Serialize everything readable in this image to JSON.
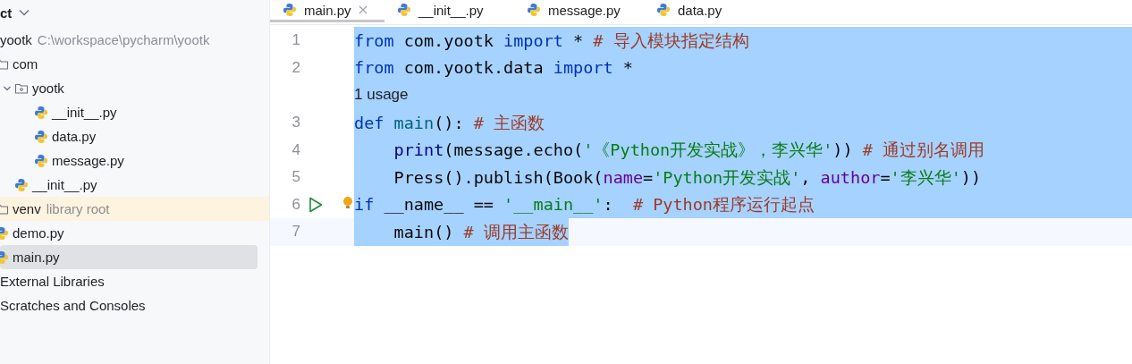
{
  "project_header": {
    "label": "ct"
  },
  "tree": [
    {
      "name": "yootk",
      "path": "C:\\workspace\\pycharm\\yootk",
      "selected": false,
      "children": [
        {
          "name": "com",
          "kind": "folder",
          "selected": false,
          "children": [
            {
              "name": "yootk",
              "kind": "package",
              "expanded": true,
              "selected": false,
              "children": [
                {
                  "name": "__init__.py",
                  "kind": "python",
                  "selected": false
                },
                {
                  "name": "data.py",
                  "kind": "python",
                  "selected": false
                },
                {
                  "name": "message.py",
                  "kind": "python",
                  "selected": false
                }
              ]
            },
            {
              "name": "__init__.py",
              "kind": "python",
              "selected": false
            }
          ]
        },
        {
          "name": "venv",
          "note": "library root",
          "kind": "folder",
          "highlighted": true,
          "selected": false
        },
        {
          "name": "demo.py",
          "kind": "python",
          "selected": false
        },
        {
          "name": "main.py",
          "kind": "python",
          "selected": true
        }
      ]
    },
    {
      "name": "External Libraries",
      "selected": false
    },
    {
      "name": "Scratches and Consoles",
      "selected": false
    }
  ],
  "tabs": [
    {
      "label": "main.py",
      "selected": true,
      "closable": true
    },
    {
      "label": "__init__.py",
      "selected": false
    },
    {
      "label": "message.py",
      "selected": false
    },
    {
      "label": "data.py",
      "selected": false
    }
  ],
  "code_lines": [
    {
      "kind": "code",
      "number": "1",
      "selected": true,
      "tokens": [
        {
          "kind": "kw",
          "s": "from"
        },
        {
          "kind": "text",
          "s": " com.yootk "
        },
        {
          "kind": "kw",
          "s": "import"
        },
        {
          "kind": "text",
          "s": " * "
        },
        {
          "kind": "comment",
          "s": "# 导入模块指定结构"
        }
      ]
    },
    {
      "kind": "code",
      "number": "2",
      "selected": true,
      "tokens": [
        {
          "kind": "kw",
          "s": "from"
        },
        {
          "kind": "text",
          "s": " com.yootk.data "
        },
        {
          "kind": "kw",
          "s": "import"
        },
        {
          "kind": "text",
          "s": " *"
        }
      ]
    },
    {
      "kind": "inlay",
      "text": "1 usage",
      "selected": true
    },
    {
      "kind": "code",
      "number": "3",
      "selected": true,
      "tokens": [
        {
          "kind": "kw",
          "s": "def"
        },
        {
          "kind": "fn",
          "s": " main"
        },
        {
          "kind": "text",
          "s": "(): "
        },
        {
          "kind": "comment",
          "s": "# 主函数"
        }
      ]
    },
    {
      "kind": "code",
      "number": "4",
      "selected": true,
      "indented": true,
      "tokens": [
        {
          "kind": "builtin",
          "s": "print"
        },
        {
          "kind": "text",
          "s": "(message.echo("
        },
        {
          "kind": "string",
          "s": "'《Python开发实战》，李兴华'"
        },
        {
          "kind": "text",
          "s": ")) "
        },
        {
          "kind": "comment",
          "s": "# 通过别名调用"
        }
      ]
    },
    {
      "kind": "code",
      "number": "5",
      "selected": true,
      "indented": true,
      "tokens": [
        {
          "kind": "text",
          "s": "Press().publish(Book("
        },
        {
          "kind": "param",
          "s": "name"
        },
        {
          "kind": "text",
          "s": "="
        },
        {
          "kind": "string",
          "s": "'Python开发实战'"
        },
        {
          "kind": "text",
          "s": ", "
        },
        {
          "kind": "param",
          "s": "author"
        },
        {
          "kind": "text",
          "s": "="
        },
        {
          "kind": "string",
          "s": "'李兴华'"
        },
        {
          "kind": "text",
          "s": "))"
        }
      ]
    },
    {
      "kind": "code",
      "number": "6",
      "selected": true,
      "run_marker": true,
      "bulb": true,
      "tokens": [
        {
          "kind": "kw",
          "s": "if"
        },
        {
          "kind": "text",
          "s": " __name__ == "
        },
        {
          "kind": "string",
          "s": "'__main__'"
        },
        {
          "kind": "text",
          "s": ":  "
        },
        {
          "kind": "comment",
          "s": "# Python程序运行起点"
        }
      ]
    },
    {
      "kind": "code",
      "number": "7",
      "selected": true,
      "indented": true,
      "selection_ends": true,
      "current": true,
      "tokens": [
        {
          "kind": "text",
          "s": "main() "
        },
        {
          "kind": "comment",
          "s": "# 调用主函数"
        }
      ]
    }
  ]
}
